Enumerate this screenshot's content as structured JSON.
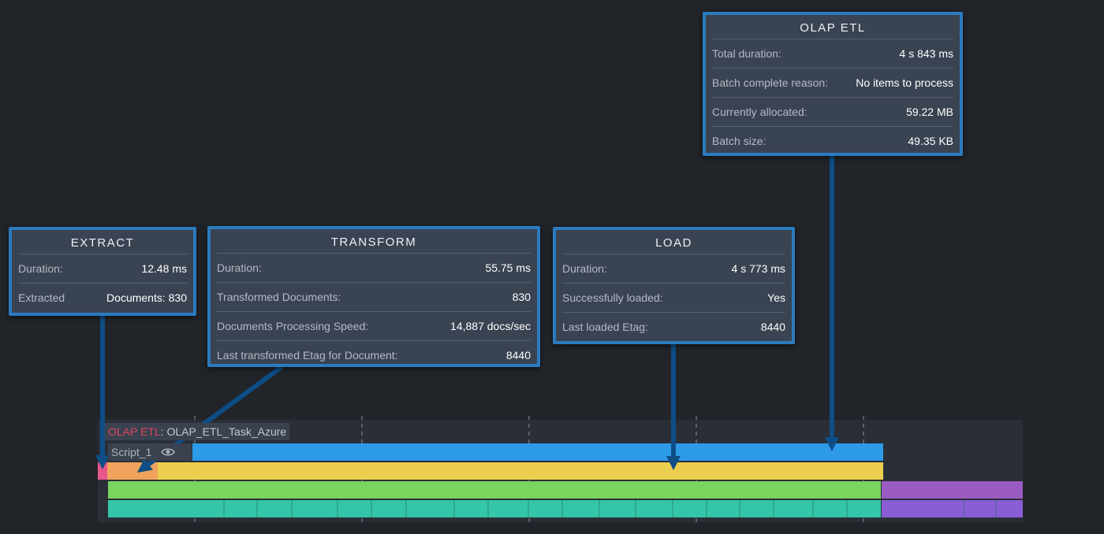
{
  "tooltips": {
    "olap": {
      "title": "OLAP ETL",
      "rows": [
        {
          "label": "Total duration:",
          "value": "4 s 843 ms"
        },
        {
          "label": "Batch complete reason:",
          "value": "No items to process"
        },
        {
          "label": "Currently allocated:",
          "value": "59.22 MB"
        },
        {
          "label": "Batch size:",
          "value": "49.35 KB"
        }
      ]
    },
    "extract": {
      "title": "EXTRACT",
      "rows": [
        {
          "label": "Duration:",
          "value": "12.48 ms"
        },
        {
          "label": "Extracted",
          "value": "Documents: 830"
        }
      ]
    },
    "transform": {
      "title": "TRANSFORM",
      "rows": [
        {
          "label": "Duration:",
          "value": "55.75 ms"
        },
        {
          "label": "Transformed Documents:",
          "value": "830"
        },
        {
          "label": "Documents Processing Speed:",
          "value": "14,887 docs/sec"
        },
        {
          "label": "Last transformed Etag for Document:",
          "value": "8440"
        }
      ]
    },
    "load": {
      "title": "LOAD",
      "rows": [
        {
          "label": "Duration:",
          "value": "4 s 773 ms"
        },
        {
          "label": "Successfully loaded:",
          "value": "Yes"
        },
        {
          "label": "Last loaded Etag:",
          "value": "8440"
        }
      ]
    }
  },
  "timeline": {
    "etl_kind": "OLAP ETL",
    "etl_separator": ": ",
    "etl_name": "OLAP_ETL_Task_Azure",
    "script_label": "Script_1",
    "eye_icon": "eye-icon"
  },
  "colors": {
    "background": "#212429",
    "tooltip_border": "#2b7bbf",
    "arrow": "#0e4d86",
    "extract": "#e8578a",
    "transform": "#f0a35c",
    "load": "#ebce4e",
    "total": "#2d9be8",
    "green": "#7bd45e",
    "teal": "#34c6a8",
    "purple": "#9a5cc1",
    "violet": "#8a5dd6"
  }
}
